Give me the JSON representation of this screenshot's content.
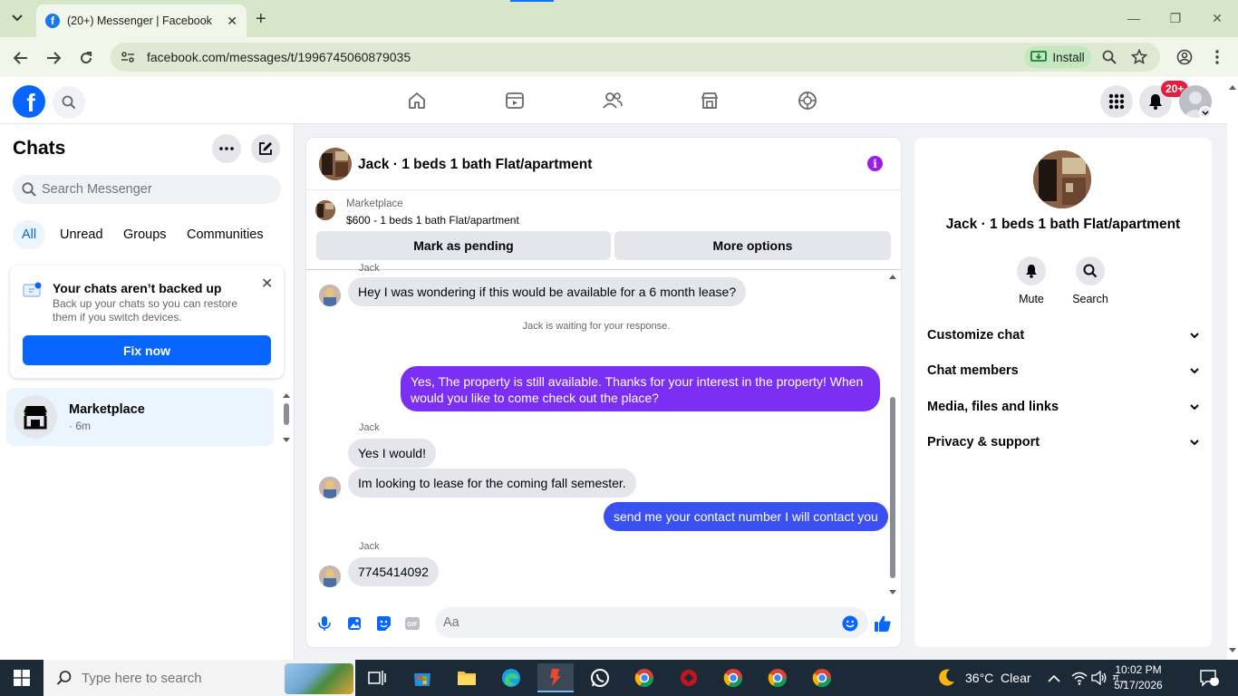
{
  "browser": {
    "tab_title": "(20+) Messenger | Facebook",
    "url": "facebook.com/messages/t/1996745060879035",
    "install_label": "Install"
  },
  "fb_header": {
    "notif_count": "20+"
  },
  "left": {
    "title": "Chats",
    "search_placeholder": "Search Messenger",
    "filters": [
      "All",
      "Unread",
      "Groups",
      "Communities"
    ],
    "backup": {
      "title": "Your chats aren’t backed up",
      "desc": "Back up your chats so you can restore them if you switch devices.",
      "button": "Fix now"
    },
    "chat_item": {
      "name": "Marketplace",
      "time": "· 6m"
    }
  },
  "chat": {
    "header_title": "Jack · 1 beds 1 bath Flat/apartment",
    "marketplace_label": "Marketplace",
    "listing": "$600 - 1 beds 1 bath Flat/apartment",
    "mark_pending": "Mark as pending",
    "more_options": "More options",
    "messages": {
      "sender_top": "Jack",
      "m1": "Hey I was wondering if this would be available for a 6 month lease?",
      "waiting": "Jack is waiting for your response.",
      "m2": "Yes, The property is still available. Thanks for your interest in the property! When would you like to come check out the place?",
      "sender2": "Jack",
      "m3": "Yes I would!",
      "m4": "Im looking to lease for the coming fall semester.",
      "m5": "send me your contact number I will contact you",
      "sender3": "Jack",
      "m6": "7745414092"
    },
    "composer_placeholder": "Aa",
    "colors": {
      "outgoing_purple": "#7b2ff2",
      "outgoing_blue": "#3b50f0"
    }
  },
  "right": {
    "name": "Jack · 1 beds 1 bath Flat/apartment",
    "mute_label": "Mute",
    "search_label": "Search",
    "rows": [
      "Customize chat",
      "Chat members",
      "Media, files and links",
      "Privacy & support"
    ]
  },
  "taskbar": {
    "search_placeholder": "Type here to search",
    "weather": "36°C  Clear",
    "time": "10:02 PM",
    "date": "5/17/2026",
    "notif_count": "1"
  }
}
